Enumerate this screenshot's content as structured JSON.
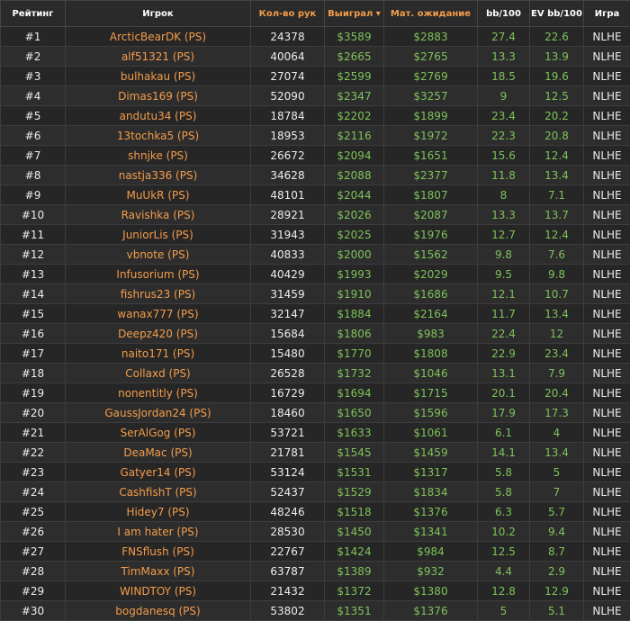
{
  "headers": {
    "rank": "Рейтинг",
    "player": "Игрок",
    "hands": "Кол-во рук",
    "won": "Выиграл",
    "ev": "Мат. ожидание",
    "bb100": "bb/100",
    "evbb100": "EV bb/100",
    "game": "Игра"
  },
  "colors": {
    "accent": "#f39c4a",
    "positive": "#7ec25a",
    "background": "#232323"
  },
  "rows": [
    {
      "rank": "#1",
      "player": "ArcticBearDK (PS)",
      "hands": "24378",
      "won": "$3589",
      "ev": "$2883",
      "bb": "27.4",
      "evbb": "22.6",
      "game": "NLHE"
    },
    {
      "rank": "#2",
      "player": "alf51321 (PS)",
      "hands": "40064",
      "won": "$2665",
      "ev": "$2765",
      "bb": "13.3",
      "evbb": "13.9",
      "game": "NLHE"
    },
    {
      "rank": "#3",
      "player": "bulhakau (PS)",
      "hands": "27074",
      "won": "$2599",
      "ev": "$2769",
      "bb": "18.5",
      "evbb": "19.6",
      "game": "NLHE"
    },
    {
      "rank": "#4",
      "player": "Dimas169 (PS)",
      "hands": "52090",
      "won": "$2347",
      "ev": "$3257",
      "bb": "9",
      "evbb": "12.5",
      "game": "NLHE"
    },
    {
      "rank": "#5",
      "player": "andutu34 (PS)",
      "hands": "18784",
      "won": "$2202",
      "ev": "$1899",
      "bb": "23.4",
      "evbb": "20.2",
      "game": "NLHE"
    },
    {
      "rank": "#6",
      "player": "13tochka5 (PS)",
      "hands": "18953",
      "won": "$2116",
      "ev": "$1972",
      "bb": "22.3",
      "evbb": "20.8",
      "game": "NLHE"
    },
    {
      "rank": "#7",
      "player": "shnjke (PS)",
      "hands": "26672",
      "won": "$2094",
      "ev": "$1651",
      "bb": "15.6",
      "evbb": "12.4",
      "game": "NLHE"
    },
    {
      "rank": "#8",
      "player": "nastja336 (PS)",
      "hands": "34628",
      "won": "$2088",
      "ev": "$2377",
      "bb": "11.8",
      "evbb": "13.4",
      "game": "NLHE"
    },
    {
      "rank": "#9",
      "player": "MuUkR (PS)",
      "hands": "48101",
      "won": "$2044",
      "ev": "$1807",
      "bb": "8",
      "evbb": "7.1",
      "game": "NLHE"
    },
    {
      "rank": "#10",
      "player": "Ravishka (PS)",
      "hands": "28921",
      "won": "$2026",
      "ev": "$2087",
      "bb": "13.3",
      "evbb": "13.7",
      "game": "NLHE"
    },
    {
      "rank": "#11",
      "player": "JuniorLis (PS)",
      "hands": "31943",
      "won": "$2025",
      "ev": "$1976",
      "bb": "12.7",
      "evbb": "12.4",
      "game": "NLHE"
    },
    {
      "rank": "#12",
      "player": "vbnote (PS)",
      "hands": "40833",
      "won": "$2000",
      "ev": "$1562",
      "bb": "9.8",
      "evbb": "7.6",
      "game": "NLHE"
    },
    {
      "rank": "#13",
      "player": "Infusorium (PS)",
      "hands": "40429",
      "won": "$1993",
      "ev": "$2029",
      "bb": "9.5",
      "evbb": "9.8",
      "game": "NLHE"
    },
    {
      "rank": "#14",
      "player": "fishrus23 (PS)",
      "hands": "31459",
      "won": "$1910",
      "ev": "$1686",
      "bb": "12.1",
      "evbb": "10.7",
      "game": "NLHE"
    },
    {
      "rank": "#15",
      "player": "wanax777 (PS)",
      "hands": "32147",
      "won": "$1884",
      "ev": "$2164",
      "bb": "11.7",
      "evbb": "13.4",
      "game": "NLHE"
    },
    {
      "rank": "#16",
      "player": "Deepz420 (PS)",
      "hands": "15684",
      "won": "$1806",
      "ev": "$983",
      "bb": "22.4",
      "evbb": "12",
      "game": "NLHE"
    },
    {
      "rank": "#17",
      "player": "naito171 (PS)",
      "hands": "15480",
      "won": "$1770",
      "ev": "$1808",
      "bb": "22.9",
      "evbb": "23.4",
      "game": "NLHE"
    },
    {
      "rank": "#18",
      "player": "Collaxd (PS)",
      "hands": "26528",
      "won": "$1732",
      "ev": "$1046",
      "bb": "13.1",
      "evbb": "7.9",
      "game": "NLHE"
    },
    {
      "rank": "#19",
      "player": "nonentitly (PS)",
      "hands": "16729",
      "won": "$1694",
      "ev": "$1715",
      "bb": "20.1",
      "evbb": "20.4",
      "game": "NLHE"
    },
    {
      "rank": "#20",
      "player": "GaussJordan24 (PS)",
      "hands": "18460",
      "won": "$1650",
      "ev": "$1596",
      "bb": "17.9",
      "evbb": "17.3",
      "game": "NLHE"
    },
    {
      "rank": "#21",
      "player": "SerAlGog (PS)",
      "hands": "53721",
      "won": "$1633",
      "ev": "$1061",
      "bb": "6.1",
      "evbb": "4",
      "game": "NLHE"
    },
    {
      "rank": "#22",
      "player": "DeaMac (PS)",
      "hands": "21781",
      "won": "$1545",
      "ev": "$1459",
      "bb": "14.1",
      "evbb": "13.4",
      "game": "NLHE"
    },
    {
      "rank": "#23",
      "player": "Gatyer14 (PS)",
      "hands": "53124",
      "won": "$1531",
      "ev": "$1317",
      "bb": "5.8",
      "evbb": "5",
      "game": "NLHE"
    },
    {
      "rank": "#24",
      "player": "CashfishT (PS)",
      "hands": "52437",
      "won": "$1529",
      "ev": "$1834",
      "bb": "5.8",
      "evbb": "7",
      "game": "NLHE"
    },
    {
      "rank": "#25",
      "player": "Hidey7 (PS)",
      "hands": "48246",
      "won": "$1518",
      "ev": "$1376",
      "bb": "6.3",
      "evbb": "5.7",
      "game": "NLHE"
    },
    {
      "rank": "#26",
      "player": "I am hater (PS)",
      "hands": "28530",
      "won": "$1450",
      "ev": "$1341",
      "bb": "10.2",
      "evbb": "9.4",
      "game": "NLHE"
    },
    {
      "rank": "#27",
      "player": "FNSflush (PS)",
      "hands": "22767",
      "won": "$1424",
      "ev": "$984",
      "bb": "12.5",
      "evbb": "8.7",
      "game": "NLHE"
    },
    {
      "rank": "#28",
      "player": "TimMaxx (PS)",
      "hands": "63787",
      "won": "$1389",
      "ev": "$932",
      "bb": "4.4",
      "evbb": "2.9",
      "game": "NLHE"
    },
    {
      "rank": "#29",
      "player": "WINDTOY (PS)",
      "hands": "21432",
      "won": "$1372",
      "ev": "$1380",
      "bb": "12.8",
      "evbb": "12.9",
      "game": "NLHE"
    },
    {
      "rank": "#30",
      "player": "bogdanesq (PS)",
      "hands": "53802",
      "won": "$1351",
      "ev": "$1376",
      "bb": "5",
      "evbb": "5.1",
      "game": "NLHE"
    }
  ]
}
